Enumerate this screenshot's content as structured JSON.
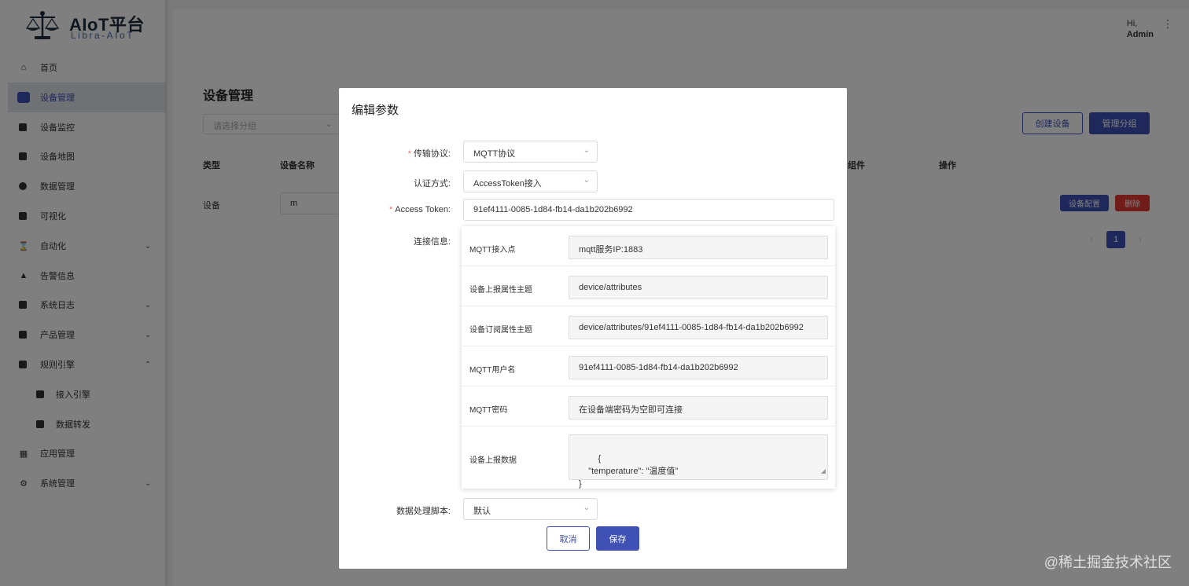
{
  "brand": {
    "title": "AIoT平台",
    "subtitle": "Libra-AIoT"
  },
  "sidebar": {
    "items": [
      {
        "label": "首页"
      },
      {
        "label": "设备管理"
      },
      {
        "label": "设备监控"
      },
      {
        "label": "设备地图"
      },
      {
        "label": "数据管理"
      },
      {
        "label": "可视化"
      },
      {
        "label": "自动化"
      },
      {
        "label": "告警信息"
      },
      {
        "label": "系统日志"
      },
      {
        "label": "产品管理"
      },
      {
        "label": "规则引擎"
      },
      {
        "label": "接入引擎"
      },
      {
        "label": "数据转发"
      },
      {
        "label": "应用管理"
      },
      {
        "label": "系统管理"
      }
    ]
  },
  "header": {
    "greeting": "Hi,",
    "username": "Admin"
  },
  "page": {
    "title": "设备管理",
    "group_placeholder": "请选择分组",
    "create_button": "创建设备",
    "manage_group_button": "管理分组",
    "columns": [
      "类型",
      "设备名称",
      "组件",
      "操作"
    ],
    "rows": [
      {
        "type": "设备",
        "name": "m",
        "config_button": "设备配置",
        "delete_button": "删除"
      }
    ],
    "pagination": {
      "current": "1"
    }
  },
  "dialog": {
    "title": "编辑参数",
    "protocol_label": "传输协议:",
    "protocol_value": "MQTT协议",
    "auth_label": "认证方式:",
    "auth_value": "AccessToken接入",
    "token_label": "Access Token:",
    "token_value": "91ef4111-0085-1d84-fb14-da1b202b6992",
    "conn_label": "连接信息:",
    "connection": [
      {
        "label": "MQTT接入点",
        "value": "mqtt服务IP:1883"
      },
      {
        "label": "设备上报属性主题",
        "value": "device/attributes"
      },
      {
        "label": "设备订阅属性主题",
        "value": "device/attributes/91ef4111-0085-1d84-fb14-da1b202b6992"
      },
      {
        "label": "MQTT用户名",
        "value": "91ef4111-0085-1d84-fb14-da1b202b6992"
      },
      {
        "label": "MQTT密码",
        "value": "在设备端密码为空即可连接"
      },
      {
        "label": "设备上报数据",
        "value": "{\n    \"temperature\": \"温度值\"\n}"
      }
    ],
    "script_label": "数据处理脚本:",
    "script_value": "默认",
    "cancel_button": "取消",
    "save_button": "保存"
  },
  "watermark": "@稀土掘金技术社区",
  "colors": {
    "primary": "#3f51b5",
    "danger": "#e53935",
    "required": "#f56c6c"
  }
}
